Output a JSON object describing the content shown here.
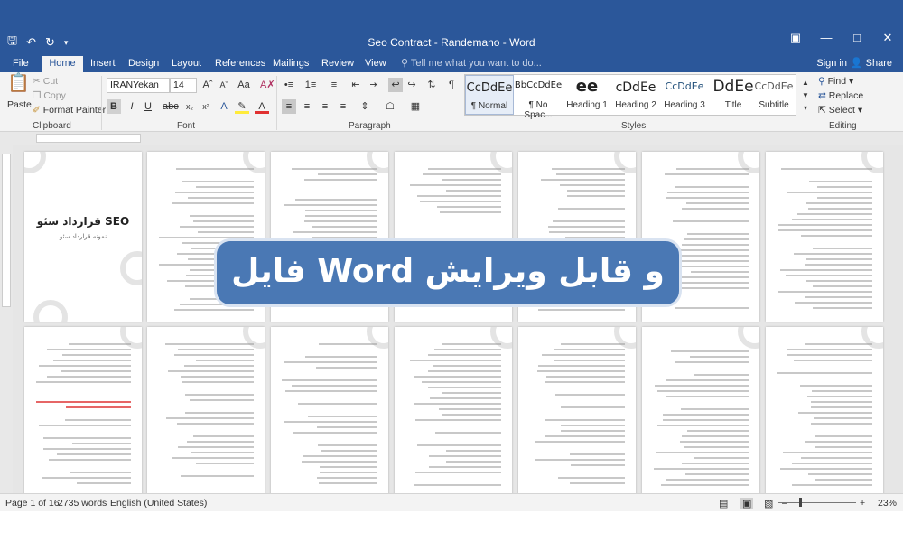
{
  "window": {
    "title": "Seo Contract - Randemano - Word"
  },
  "quick_access": {
    "save_icon": "save-icon",
    "undo_icon": "undo-icon",
    "redo_icon": "redo-icon",
    "customize_icon": "customize-icon"
  },
  "window_controls": {
    "restore_icon": "ribbon-display-icon",
    "minimize": "—",
    "maximize": "□",
    "close": "✕"
  },
  "tabs": [
    "File",
    "Home",
    "Insert",
    "Design",
    "Layout",
    "References",
    "Mailings",
    "Review",
    "View"
  ],
  "active_tab": "Home",
  "tell_me": "Tell me what you want to do...",
  "account": {
    "sign_in": "Sign in",
    "share": "Share"
  },
  "clipboard": {
    "paste": "Paste",
    "cut": "Cut",
    "copy": "Copy",
    "format_painter": "Format Painter",
    "label": "Clipboard"
  },
  "font": {
    "name": "IRANYekan",
    "size": "14",
    "label": "Font"
  },
  "paragraph": {
    "label": "Paragraph"
  },
  "styles": {
    "label": "Styles",
    "items": [
      {
        "preview": "CcDdEe",
        "name": "¶ Normal"
      },
      {
        "preview": "BbCcDdEe",
        "name": "¶ No Spac..."
      },
      {
        "preview": "ee",
        "name": "Heading 1"
      },
      {
        "preview": "cDdEe",
        "name": "Heading 2"
      },
      {
        "preview": "CcDdEe",
        "name": "Heading 3"
      },
      {
        "preview": "DdEe",
        "name": "Title"
      },
      {
        "preview": "CcDdEe",
        "name": "Subtitle"
      }
    ]
  },
  "editing": {
    "find": "Find",
    "replace": "Replace",
    "select": "Select",
    "label": "Editing"
  },
  "document": {
    "cover_title": "قرارداد سئو SEO",
    "cover_subtitle": "نمونه قرارداد سئو"
  },
  "banner": {
    "text": "فایل Word و قابل ویرایش"
  },
  "status": {
    "page": "Page 1 of 16",
    "words": "2735 words",
    "language": "English (United States)",
    "zoom": "23%",
    "zoom_fraction": 0.23
  },
  "colors": {
    "word_blue": "#2b579a",
    "banner_blue": "#4a78b4"
  }
}
